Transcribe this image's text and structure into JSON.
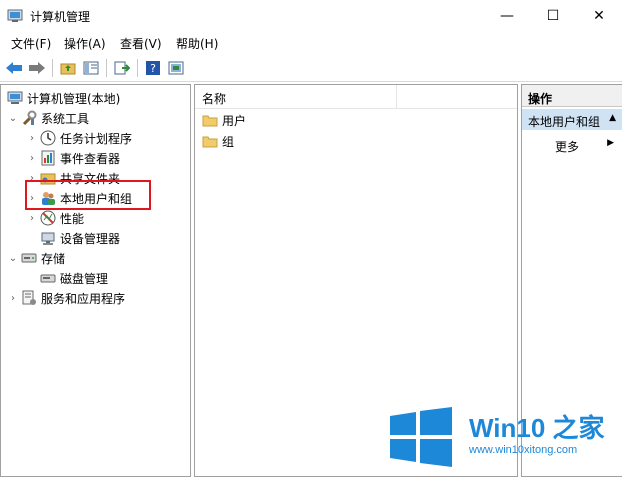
{
  "window": {
    "title": "计算机管理",
    "min_glyph": "—",
    "max_glyph": "☐",
    "close_glyph": "✕"
  },
  "menu": [
    "文件(F)",
    "操作(A)",
    "查看(V)",
    "帮助(H)"
  ],
  "toolbar": {
    "buttons": [
      "back-icon",
      "forward-icon",
      "up-folder-icon",
      "show-tree-icon",
      "export-list-icon",
      "help-icon",
      "properties-icon"
    ]
  },
  "tree": [
    {
      "label": "计算机管理(本地)",
      "icon": "computer-management-icon",
      "arrow": ""
    },
    {
      "label": "系统工具",
      "icon": "system-tools-icon",
      "arrow": "⌄"
    },
    {
      "label": "任务计划程序",
      "icon": "clock-icon",
      "arrow": "›"
    },
    {
      "label": "事件查看器",
      "icon": "event-viewer-icon",
      "arrow": "›"
    },
    {
      "label": "共享文件夹",
      "icon": "shared-folder-icon",
      "arrow": "›"
    },
    {
      "label": "本地用户和组",
      "icon": "local-users-icon",
      "arrow": "›"
    },
    {
      "label": "性能",
      "icon": "performance-icon",
      "arrow": "›"
    },
    {
      "label": "设备管理器",
      "icon": "device-manager-icon",
      "arrow": ""
    },
    {
      "label": "存储",
      "icon": "storage-icon",
      "arrow": "⌄"
    },
    {
      "label": "磁盘管理",
      "icon": "disk-icon",
      "arrow": ""
    },
    {
      "label": "服务和应用程序",
      "icon": "services-icon",
      "arrow": "›"
    }
  ],
  "list": {
    "column_name": "名称",
    "items": [
      "用户",
      "组"
    ]
  },
  "actions": {
    "header": "操作",
    "selected": "本地用户和组",
    "more": "更多"
  },
  "watermark": {
    "brand": "Win10 之家",
    "url": "www.win10xitong.com"
  },
  "colors": {
    "highlight_box": "#e0171f",
    "selection": "#cfe3f5",
    "watermark_blue": "#1e88d8"
  }
}
